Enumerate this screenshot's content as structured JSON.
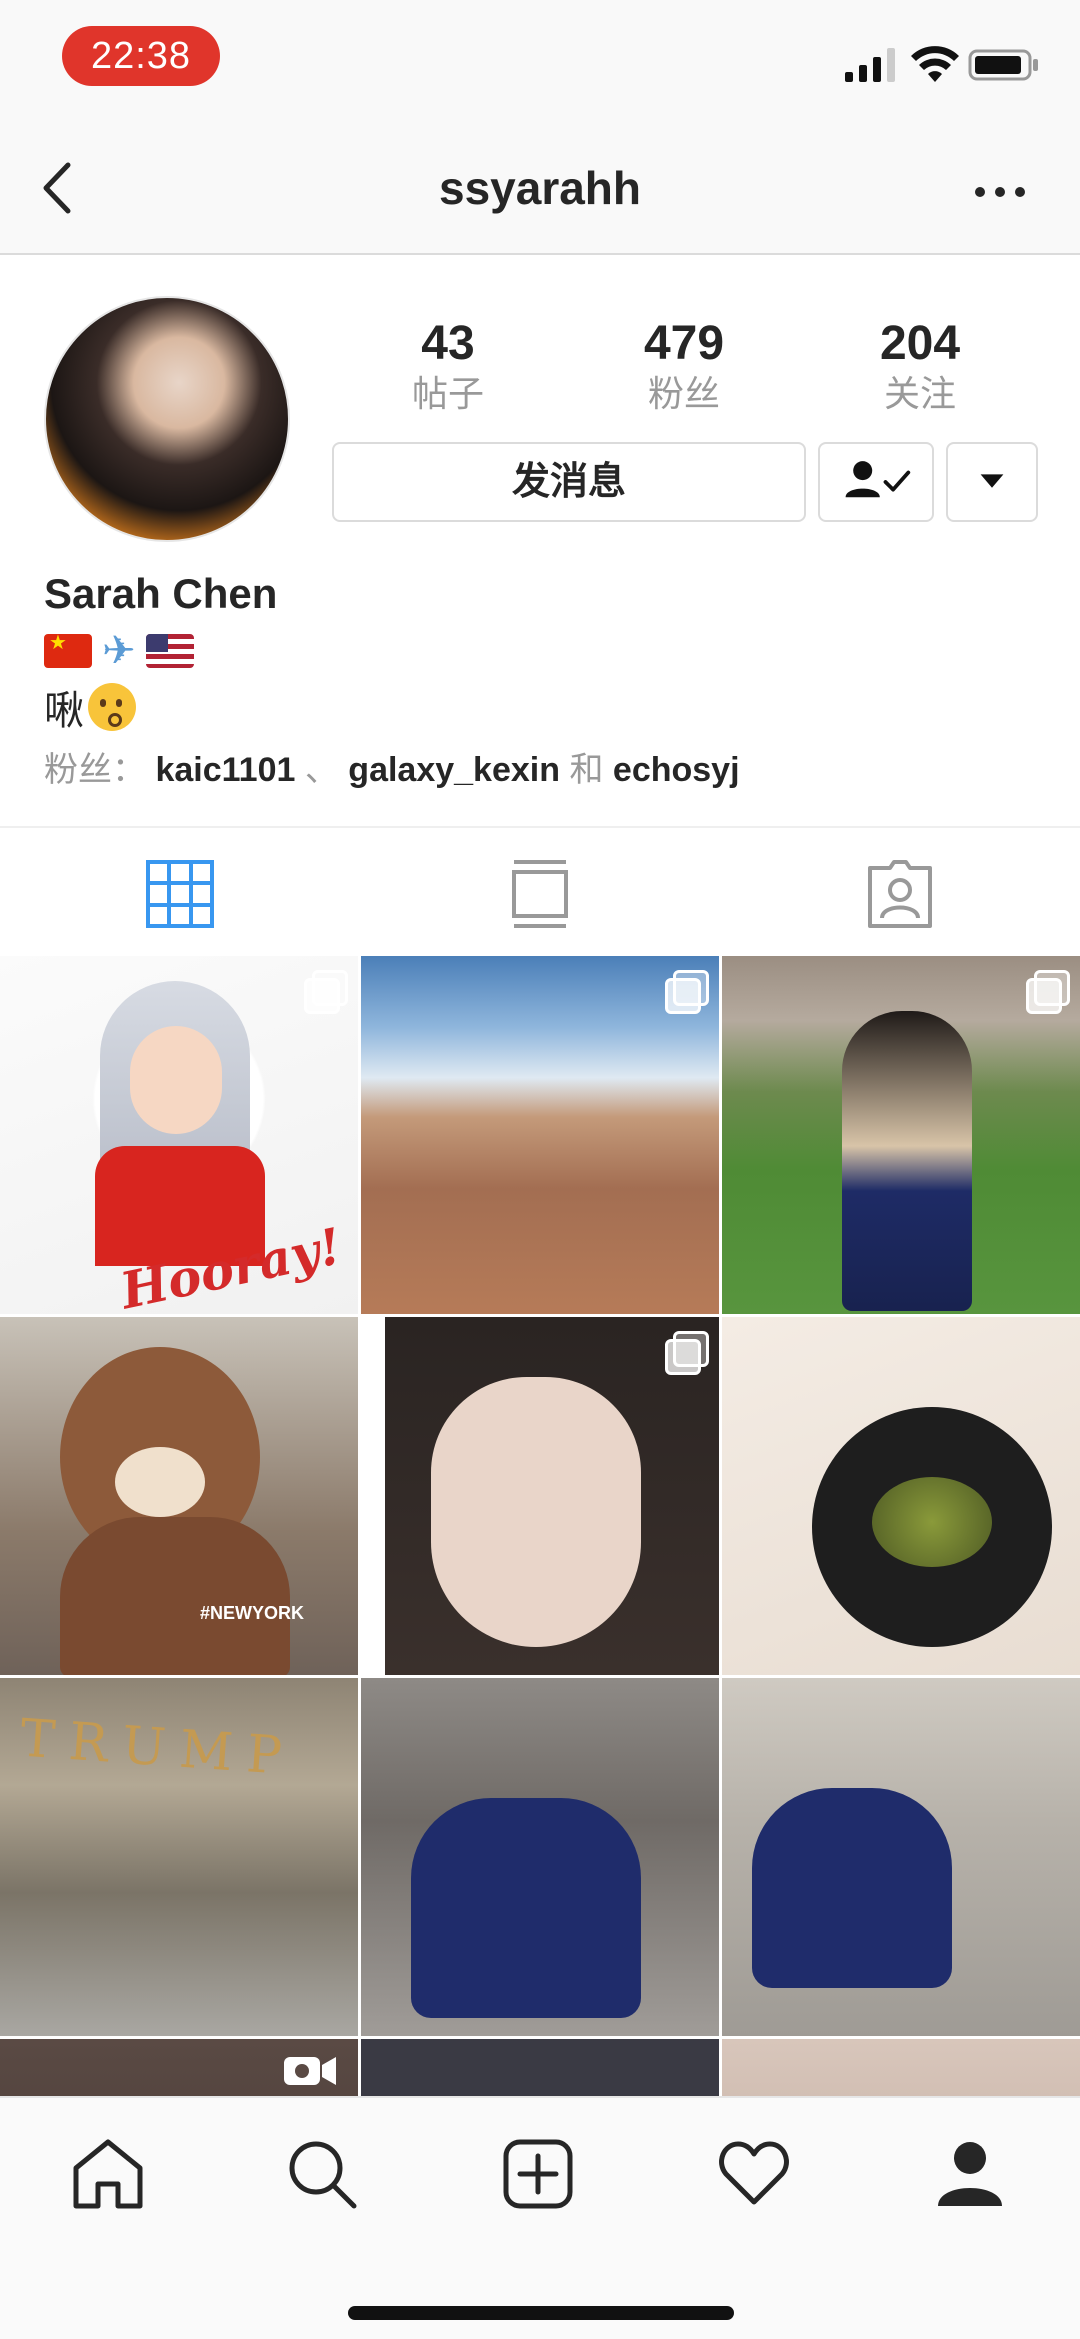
{
  "status_bar": {
    "time": "22:38"
  },
  "nav": {
    "title": "ssyarahh"
  },
  "profile": {
    "stats": [
      {
        "value": "43",
        "label": "帖子"
      },
      {
        "value": "479",
        "label": "粉丝"
      },
      {
        "value": "204",
        "label": "关注"
      }
    ],
    "message_button": "发消息",
    "name": "Sarah Chen",
    "bio_text": "啾",
    "followed_by": {
      "prefix": "粉丝：",
      "user1": "kaic1101",
      "sep": "、",
      "user2": "galaxy_kexin",
      "conj": "和",
      "user3": "echosyj"
    }
  },
  "grid_overlays": {
    "tile5_caption": "#NEWYORK",
    "tile1_caption": "Hooray!",
    "tile7_caption": "TRUMP"
  },
  "colors": {
    "accent_blue": "#3897f0",
    "status_red": "#e0352b",
    "text_dark": "#262626",
    "text_grey": "#999999"
  }
}
